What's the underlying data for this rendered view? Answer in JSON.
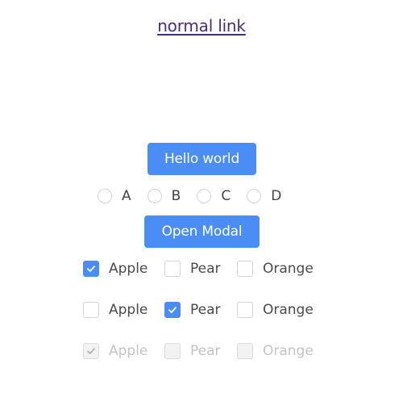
{
  "link": {
    "label": "normal link"
  },
  "buttons": {
    "hello": "Hello world",
    "modal": "Open Modal"
  },
  "radio_group": {
    "options": [
      {
        "label": "A",
        "selected": false
      },
      {
        "label": "B",
        "selected": false
      },
      {
        "label": "C",
        "selected": false
      },
      {
        "label": "D",
        "selected": false
      }
    ]
  },
  "checkbox_groups": [
    {
      "disabled": false,
      "options": [
        {
          "label": "Apple",
          "checked": true
        },
        {
          "label": "Pear",
          "checked": false
        },
        {
          "label": "Orange",
          "checked": false
        }
      ]
    },
    {
      "disabled": false,
      "options": [
        {
          "label": "Apple",
          "checked": false
        },
        {
          "label": "Pear",
          "checked": true
        },
        {
          "label": "Orange",
          "checked": false
        }
      ]
    },
    {
      "disabled": true,
      "options": [
        {
          "label": "Apple",
          "checked": true
        },
        {
          "label": "Pear",
          "checked": false
        },
        {
          "label": "Orange",
          "checked": false
        }
      ]
    }
  ],
  "colors": {
    "primary": "#4a8ef5",
    "link": "#4b2c7a",
    "disabled_text": "#c4c4c4",
    "border": "#d4d4d4"
  }
}
